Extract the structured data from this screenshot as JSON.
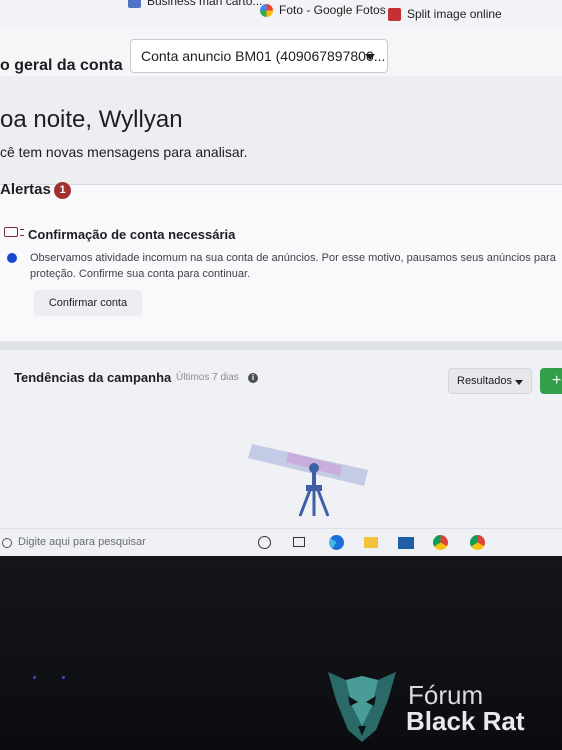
{
  "bookmarks": [
    {
      "label": "Business man carto..."
    },
    {
      "label": "Foto - Google Fotos"
    },
    {
      "label": "Split image online"
    }
  ],
  "header": {
    "title": "o geral da conta",
    "account_selector": {
      "value": "Conta anuncio BM01 (409067897800..."
    }
  },
  "greeting": {
    "title": "oa noite, Wyllyan",
    "subtitle": "cê tem novas mensagens para analisar."
  },
  "alerts": {
    "title": "Alertas",
    "count": "1",
    "item": {
      "title": "Confirmação de conta necessária",
      "message": "Observamos atividade incomum na sua conta de anúncios. Por esse motivo, pausamos seus anúncios para proteção. Confirme sua conta para continuar.",
      "button": "Confirmar conta"
    }
  },
  "trends": {
    "title": "Tendências da campanha",
    "range": "Últimos 7 dias",
    "info_glyph": "i",
    "results_select": "Resultados",
    "add_button": "+"
  },
  "taskbar": {
    "search_placeholder": "Digite aqui para pesquisar"
  },
  "watermark": {
    "line1": "Fórum",
    "line2": "Black Rat"
  },
  "colors": {
    "alert_badge": "#a0312e",
    "blue_dot": "#1a46d6",
    "add_button": "#32a04a",
    "telescope": "#3e5fa6"
  }
}
